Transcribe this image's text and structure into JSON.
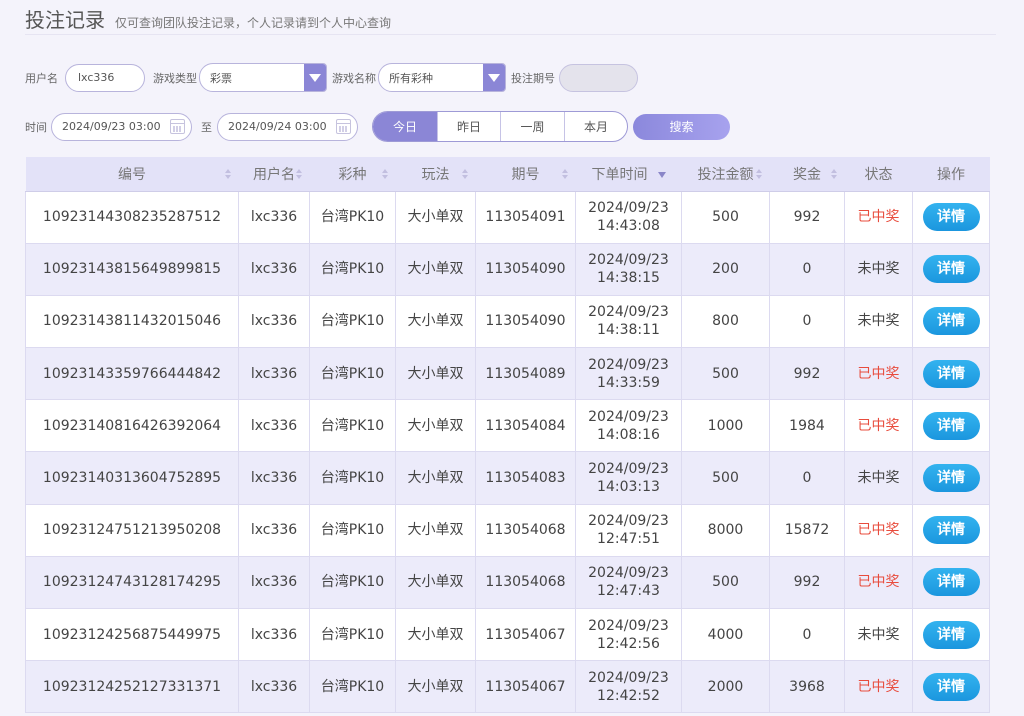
{
  "header": {
    "title": "投注记录",
    "subtitle": "仅可查询团队投注记录，个人记录请到个人中心查询"
  },
  "filters": {
    "username_label": "用户名",
    "username_value": "lxc336",
    "game_type_label": "游戏类型",
    "game_type_value": "彩票",
    "game_name_label": "游戏名称",
    "game_name_value": "所有彩种",
    "period_label": "投注期号",
    "period_value": "",
    "time_label": "时间",
    "start_time": "2024/09/23 03:00",
    "to_label": "至",
    "end_time": "2024/09/24 03:00",
    "quick_ranges": [
      "今日",
      "昨日",
      "一周",
      "本月"
    ],
    "active_range": "今日",
    "search_label": "搜索"
  },
  "table": {
    "columns": [
      "编号",
      "用户名",
      "彩种",
      "玩法",
      "期号",
      "下单时间",
      "投注金额",
      "奖金",
      "状态",
      "操作"
    ],
    "detail_label": "详情",
    "rows": [
      {
        "id": "10923144308235287512",
        "user": "lxc336",
        "lottery": "台湾PK10",
        "play": "大小单双",
        "period": "113054091",
        "date": "2024/09/23",
        "time": "14:43:08",
        "amount": "500",
        "bonus": "992",
        "status": "已中奖",
        "won": true
      },
      {
        "id": "10923143815649899815",
        "user": "lxc336",
        "lottery": "台湾PK10",
        "play": "大小单双",
        "period": "113054090",
        "date": "2024/09/23",
        "time": "14:38:15",
        "amount": "200",
        "bonus": "0",
        "status": "未中奖",
        "won": false
      },
      {
        "id": "10923143811432015046",
        "user": "lxc336",
        "lottery": "台湾PK10",
        "play": "大小单双",
        "period": "113054090",
        "date": "2024/09/23",
        "time": "14:38:11",
        "amount": "800",
        "bonus": "0",
        "status": "未中奖",
        "won": false
      },
      {
        "id": "10923143359766444842",
        "user": "lxc336",
        "lottery": "台湾PK10",
        "play": "大小单双",
        "period": "113054089",
        "date": "2024/09/23",
        "time": "14:33:59",
        "amount": "500",
        "bonus": "992",
        "status": "已中奖",
        "won": true
      },
      {
        "id": "10923140816426392064",
        "user": "lxc336",
        "lottery": "台湾PK10",
        "play": "大小单双",
        "period": "113054084",
        "date": "2024/09/23",
        "time": "14:08:16",
        "amount": "1000",
        "bonus": "1984",
        "status": "已中奖",
        "won": true
      },
      {
        "id": "10923140313604752895",
        "user": "lxc336",
        "lottery": "台湾PK10",
        "play": "大小单双",
        "period": "113054083",
        "date": "2024/09/23",
        "time": "14:03:13",
        "amount": "500",
        "bonus": "0",
        "status": "未中奖",
        "won": false
      },
      {
        "id": "10923124751213950208",
        "user": "lxc336",
        "lottery": "台湾PK10",
        "play": "大小单双",
        "period": "113054068",
        "date": "2024/09/23",
        "time": "12:47:51",
        "amount": "8000",
        "bonus": "15872",
        "status": "已中奖",
        "won": true
      },
      {
        "id": "10923124743128174295",
        "user": "lxc336",
        "lottery": "台湾PK10",
        "play": "大小单双",
        "period": "113054068",
        "date": "2024/09/23",
        "time": "12:47:43",
        "amount": "500",
        "bonus": "992",
        "status": "已中奖",
        "won": true
      },
      {
        "id": "10923124256875449975",
        "user": "lxc336",
        "lottery": "台湾PK10",
        "play": "大小单双",
        "period": "113054067",
        "date": "2024/09/23",
        "time": "12:42:56",
        "amount": "4000",
        "bonus": "0",
        "status": "未中奖",
        "won": false
      },
      {
        "id": "10923124252127331371",
        "user": "lxc336",
        "lottery": "台湾PK10",
        "play": "大小单双",
        "period": "113054067",
        "date": "2024/09/23",
        "time": "12:42:52",
        "amount": "2000",
        "bonus": "3968",
        "status": "已中奖",
        "won": true
      }
    ]
  },
  "colors": {
    "accent": "#8b86d6",
    "win": "#e84c3d",
    "detail_button": "#1b96de"
  }
}
